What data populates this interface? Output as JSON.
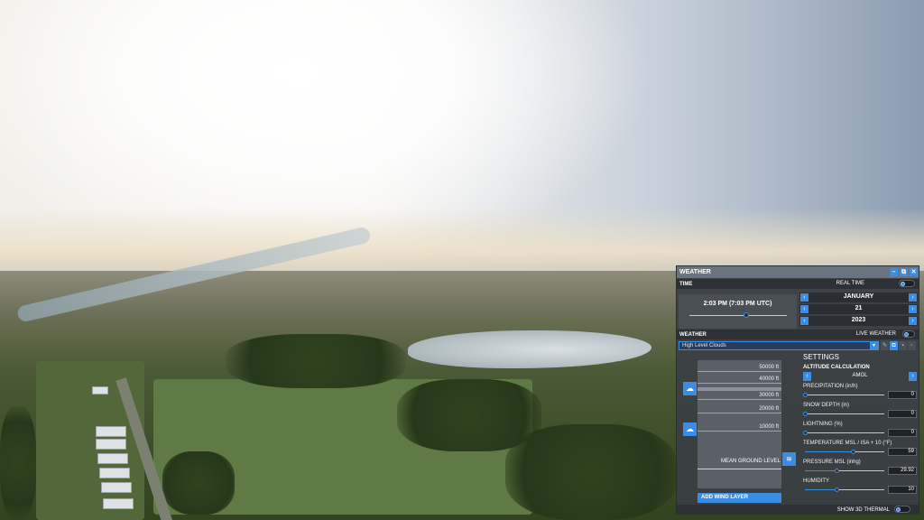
{
  "panel": {
    "title": "WEATHER",
    "controls": {
      "minimize": "–",
      "popout": "⧉",
      "close": "✕"
    }
  },
  "time": {
    "section_label": "TIME",
    "real_time_label": "REAL TIME",
    "clock": "2:03 PM (7:03 PM UTC)",
    "time_of_day_fraction": 0.58,
    "month": "JANUARY",
    "day": "21",
    "year": "2023"
  },
  "weather": {
    "section_label": "WEATHER",
    "live_weather_label": "LIVE WEATHER",
    "preset": "High Level Clouds"
  },
  "layers": {
    "altitudes": [
      "50000 ft",
      "40000 ft",
      "30000 ft",
      "20000 ft",
      "10000 ft"
    ],
    "mean_ground_level": "MEAN GROUND LEVEL",
    "add_wind_layer": "ADD WIND LAYER"
  },
  "settings": {
    "title": "SETTINGS",
    "altitude_calc_label": "ALTITUDE CALCULATION",
    "altitude_calc_value": "AMGL",
    "items": [
      {
        "label": "PRECIPITATION (in/h)",
        "value": "0",
        "level": 0.0
      },
      {
        "label": "SNOW DEPTH (in)",
        "value": "0",
        "level": 0.0
      },
      {
        "label": "LIGHTNING (%)",
        "value": "0",
        "level": 0.0
      },
      {
        "label": "TEMPERATURE MSL / ISA + 10 (°F)",
        "value": "59",
        "level": 0.6
      },
      {
        "label": "PRESSURE MSL (inhg)",
        "value": "29.92",
        "level": 0.4
      },
      {
        "label": "HUMIDITY",
        "value": "10",
        "level": 0.4
      }
    ]
  },
  "footer": {
    "show_3d_thermal_label": "SHOW 3D THERMAL"
  },
  "colors": {
    "accent": "#3b8de3",
    "panel_bg": "#3a3e44",
    "titlebar": "#6a7380"
  },
  "icons": {
    "cloud": "cloud-icon",
    "wind": "wind-icon",
    "arrow_left": "chevron-left-icon",
    "arrow_right": "chevron-right-icon"
  }
}
